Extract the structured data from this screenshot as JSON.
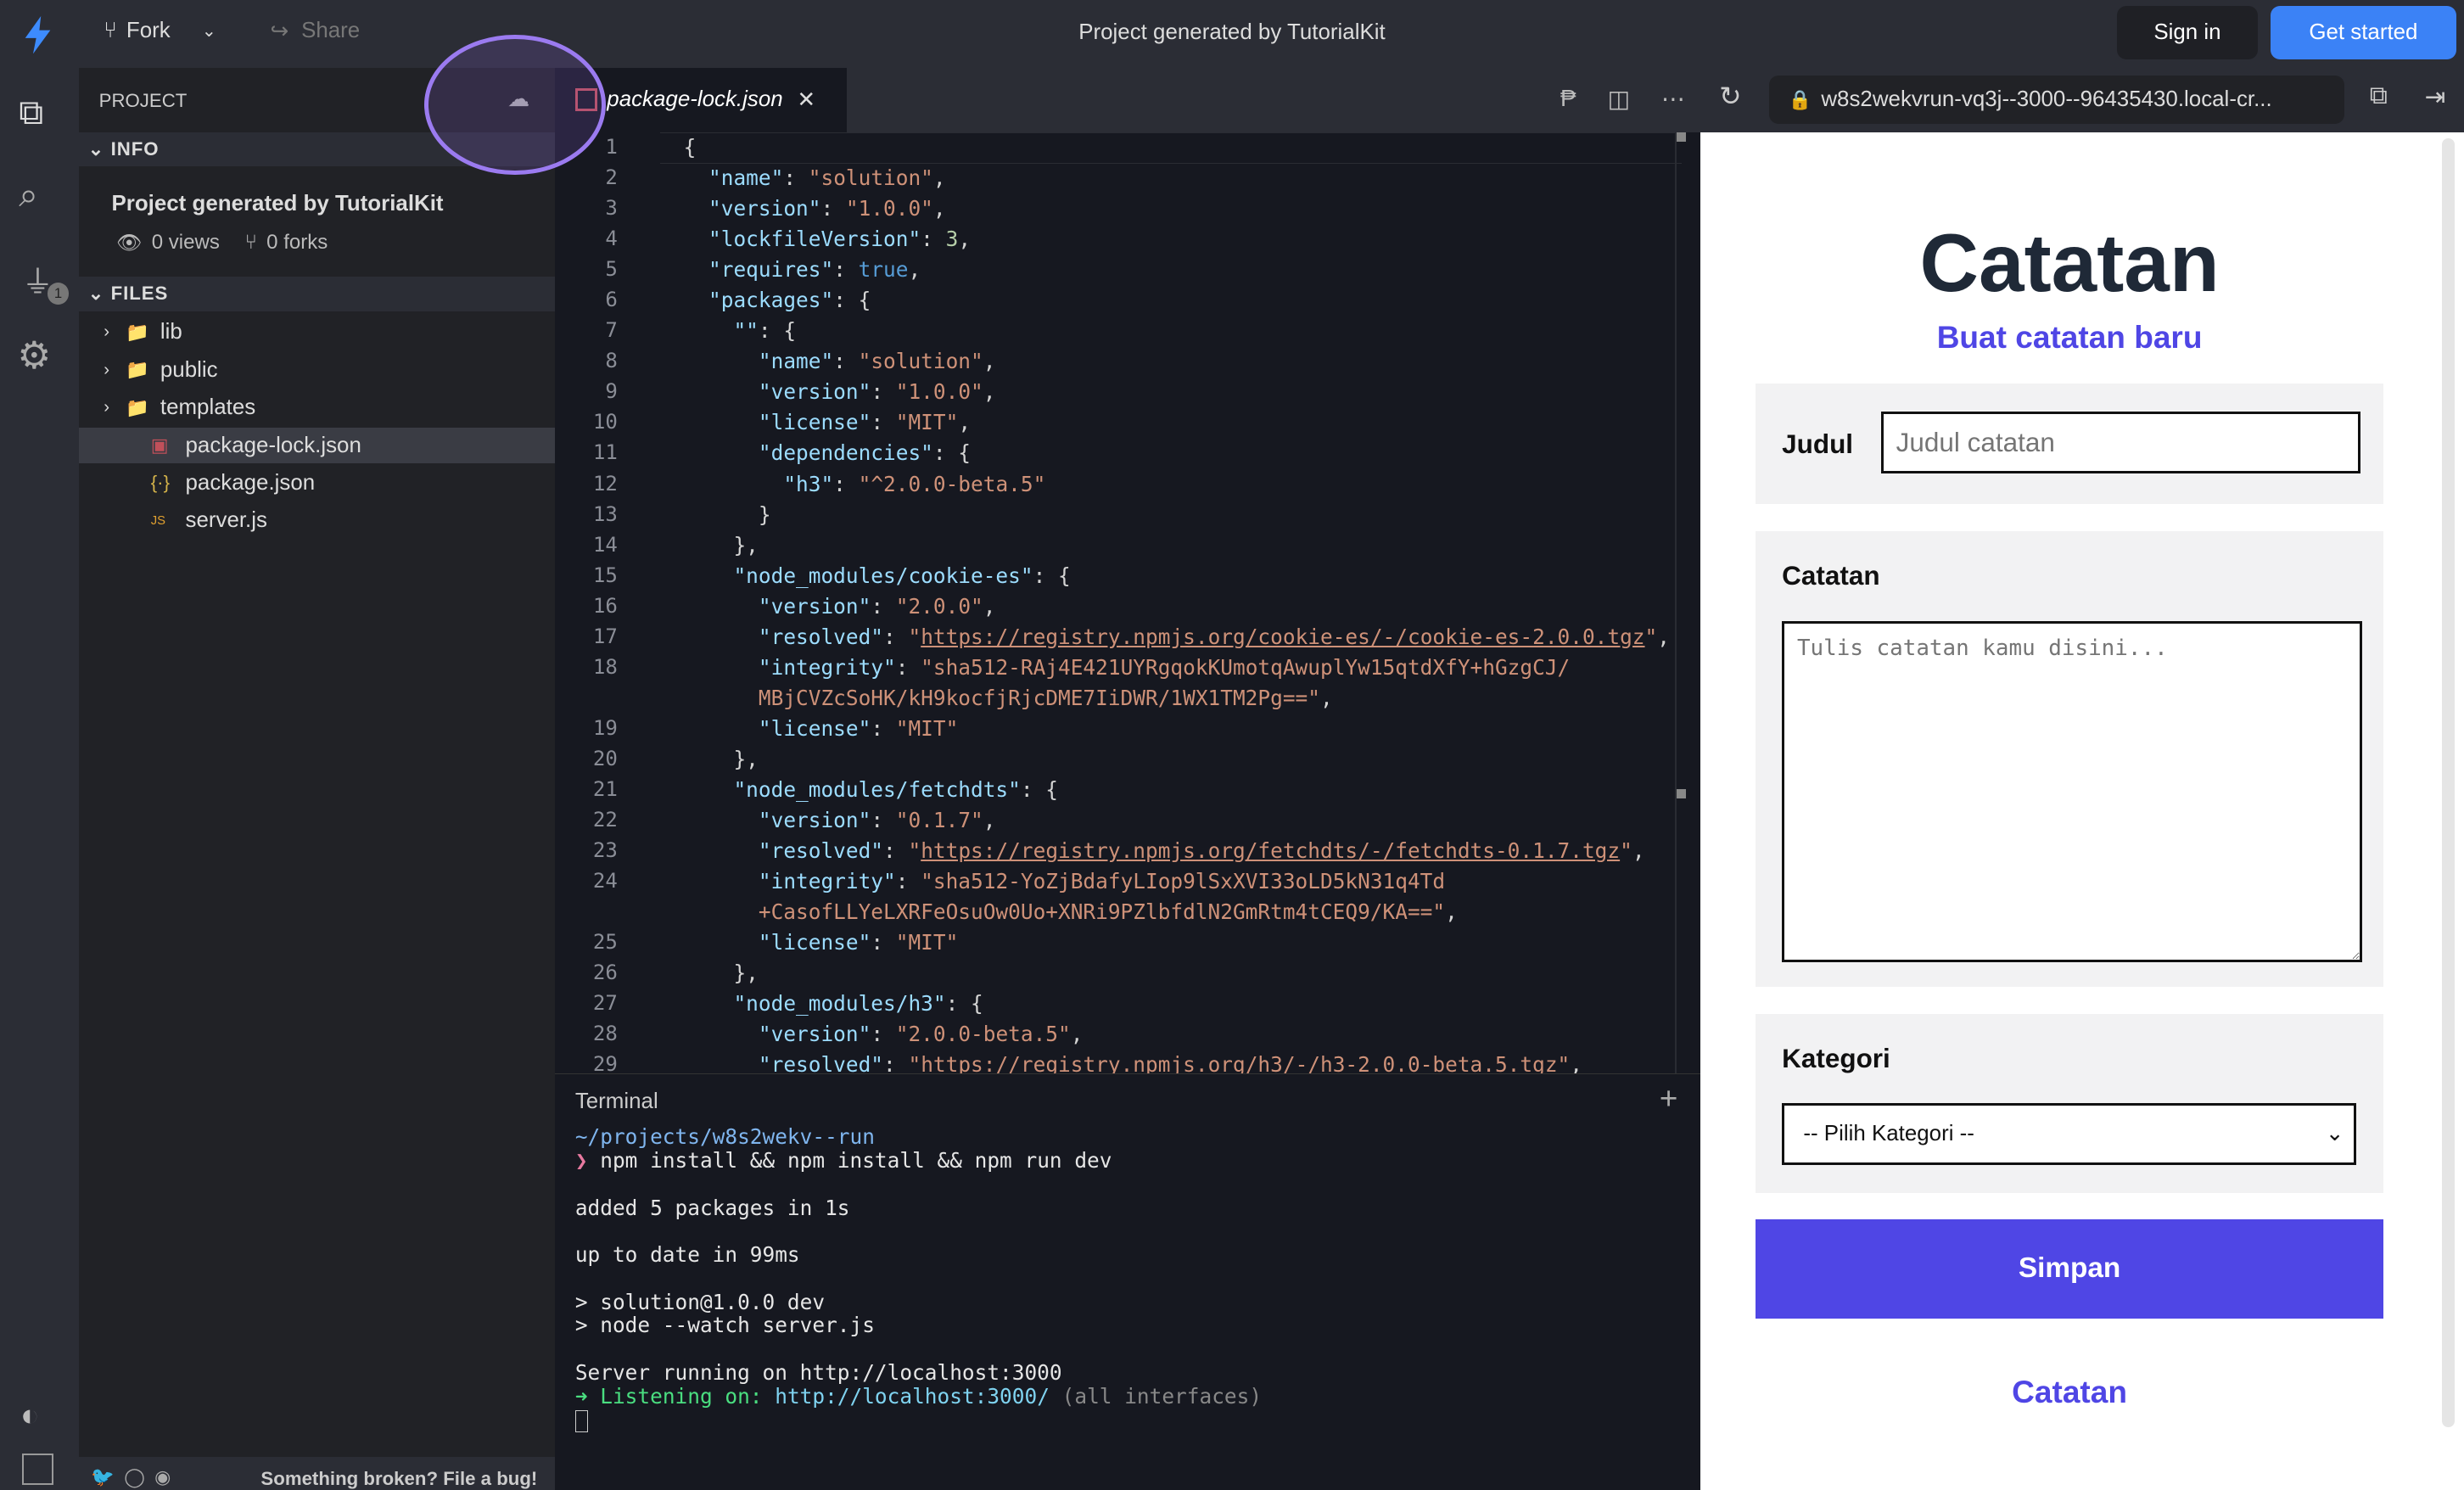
{
  "topbar": {
    "fork": "Fork",
    "share": "Share",
    "title": "Project generated by TutorialKit",
    "sign_in": "Sign in",
    "get_started": "Get started"
  },
  "sidebar": {
    "project": "PROJECT",
    "info": "INFO",
    "project_title": "Project generated by TutorialKit",
    "views": "0 views",
    "forks": "0 forks",
    "files": "FILES",
    "badge": "1",
    "items": [
      {
        "label": "lib",
        "type": "folder"
      },
      {
        "label": "public",
        "type": "folder"
      },
      {
        "label": "templates",
        "type": "folder"
      },
      {
        "label": "package-lock.json",
        "type": "npm"
      },
      {
        "label": "package.json",
        "type": "json"
      },
      {
        "label": "server.js",
        "type": "js"
      }
    ],
    "footer": "Something broken? File a bug!"
  },
  "editor": {
    "tab": "package-lock.json",
    "url": "w8s2wekvrun-vq3j--3000--96435430.local-cr...",
    "lines": [
      [
        "1",
        [
          [
            "p",
            "{"
          ]
        ]
      ],
      [
        "2",
        [
          [
            "p",
            "  "
          ],
          [
            "k",
            "\"name\""
          ],
          [
            "p",
            ": "
          ],
          [
            "s",
            "\"solution\""
          ],
          [
            "p",
            ","
          ]
        ]
      ],
      [
        "3",
        [
          [
            "p",
            "  "
          ],
          [
            "k",
            "\"version\""
          ],
          [
            "p",
            ": "
          ],
          [
            "s",
            "\"1.0.0\""
          ],
          [
            "p",
            ","
          ]
        ]
      ],
      [
        "4",
        [
          [
            "p",
            "  "
          ],
          [
            "k",
            "\"lockfileVersion\""
          ],
          [
            "p",
            ": "
          ],
          [
            "n",
            "3"
          ],
          [
            "p",
            ","
          ]
        ]
      ],
      [
        "5",
        [
          [
            "p",
            "  "
          ],
          [
            "k",
            "\"requires\""
          ],
          [
            "p",
            ": "
          ],
          [
            "b",
            "true"
          ],
          [
            "p",
            ","
          ]
        ]
      ],
      [
        "6",
        [
          [
            "p",
            "  "
          ],
          [
            "k",
            "\"packages\""
          ],
          [
            "p",
            ": {"
          ]
        ]
      ],
      [
        "7",
        [
          [
            "p",
            "    "
          ],
          [
            "k",
            "\"\""
          ],
          [
            "p",
            ": {"
          ]
        ]
      ],
      [
        "8",
        [
          [
            "p",
            "      "
          ],
          [
            "k",
            "\"name\""
          ],
          [
            "p",
            ": "
          ],
          [
            "s",
            "\"solution\""
          ],
          [
            "p",
            ","
          ]
        ]
      ],
      [
        "9",
        [
          [
            "p",
            "      "
          ],
          [
            "k",
            "\"version\""
          ],
          [
            "p",
            ": "
          ],
          [
            "s",
            "\"1.0.0\""
          ],
          [
            "p",
            ","
          ]
        ]
      ],
      [
        "10",
        [
          [
            "p",
            "      "
          ],
          [
            "k",
            "\"license\""
          ],
          [
            "p",
            ": "
          ],
          [
            "s",
            "\"MIT\""
          ],
          [
            "p",
            ","
          ]
        ]
      ],
      [
        "11",
        [
          [
            "p",
            "      "
          ],
          [
            "k",
            "\"dependencies\""
          ],
          [
            "p",
            ": {"
          ]
        ]
      ],
      [
        "12",
        [
          [
            "p",
            "        "
          ],
          [
            "k",
            "\"h3\""
          ],
          [
            "p",
            ": "
          ],
          [
            "s",
            "\"^2.0.0-beta.5\""
          ]
        ]
      ],
      [
        "13",
        [
          [
            "p",
            "      }"
          ]
        ]
      ],
      [
        "14",
        [
          [
            "p",
            "    },"
          ]
        ]
      ],
      [
        "15",
        [
          [
            "p",
            "    "
          ],
          [
            "k",
            "\"node_modules/cookie-es\""
          ],
          [
            "p",
            ": {"
          ]
        ]
      ],
      [
        "16",
        [
          [
            "p",
            "      "
          ],
          [
            "k",
            "\"version\""
          ],
          [
            "p",
            ": "
          ],
          [
            "s",
            "\"2.0.0\""
          ],
          [
            "p",
            ","
          ]
        ]
      ],
      [
        "17",
        [
          [
            "p",
            "      "
          ],
          [
            "k",
            "\"resolved\""
          ],
          [
            "p",
            ": "
          ],
          [
            "s",
            "\""
          ],
          [
            "u",
            "https://registry.npmjs.org/cookie-es/-/cookie-es-2.0.0.tgz"
          ],
          [
            "s",
            "\""
          ],
          [
            "p",
            ","
          ]
        ]
      ],
      [
        "18",
        [
          [
            "p",
            "      "
          ],
          [
            "k",
            "\"integrity\""
          ],
          [
            "p",
            ": "
          ],
          [
            "s",
            "\"sha512-RAj4E421UYRgqokKUmotqAwuplYw15qtdXfY+hGzgCJ/"
          ]
        ]
      ],
      [
        "",
        [
          [
            "s",
            "      MBjCVZcSoHK/kH9kocfjRjcDME7IiDWR/1WX1TM2Pg==\""
          ],
          [
            "p",
            ","
          ]
        ]
      ],
      [
        "19",
        [
          [
            "p",
            "      "
          ],
          [
            "k",
            "\"license\""
          ],
          [
            "p",
            ": "
          ],
          [
            "s",
            "\"MIT\""
          ]
        ]
      ],
      [
        "20",
        [
          [
            "p",
            "    },"
          ]
        ]
      ],
      [
        "21",
        [
          [
            "p",
            "    "
          ],
          [
            "k",
            "\"node_modules/fetchdts\""
          ],
          [
            "p",
            ": {"
          ]
        ]
      ],
      [
        "22",
        [
          [
            "p",
            "      "
          ],
          [
            "k",
            "\"version\""
          ],
          [
            "p",
            ": "
          ],
          [
            "s",
            "\"0.1.7\""
          ],
          [
            "p",
            ","
          ]
        ]
      ],
      [
        "23",
        [
          [
            "p",
            "      "
          ],
          [
            "k",
            "\"resolved\""
          ],
          [
            "p",
            ": "
          ],
          [
            "s",
            "\""
          ],
          [
            "u",
            "https://registry.npmjs.org/fetchdts/-/fetchdts-0.1.7.tgz"
          ],
          [
            "s",
            "\""
          ],
          [
            "p",
            ","
          ]
        ]
      ],
      [
        "24",
        [
          [
            "p",
            "      "
          ],
          [
            "k",
            "\"integrity\""
          ],
          [
            "p",
            ": "
          ],
          [
            "s",
            "\"sha512-YoZjBdafyLIop9lSxXVI33oLD5kN31q4Td"
          ]
        ]
      ],
      [
        "",
        [
          [
            "s",
            "      +CasofLLYeLXRFeOsuOw0Uo+XNRi9PZlbfdlN2GmRtm4tCEQ9/KA==\""
          ],
          [
            "p",
            ","
          ]
        ]
      ],
      [
        "25",
        [
          [
            "p",
            "      "
          ],
          [
            "k",
            "\"license\""
          ],
          [
            "p",
            ": "
          ],
          [
            "s",
            "\"MIT\""
          ]
        ]
      ],
      [
        "26",
        [
          [
            "p",
            "    },"
          ]
        ]
      ],
      [
        "27",
        [
          [
            "p",
            "    "
          ],
          [
            "k",
            "\"node_modules/h3\""
          ],
          [
            "p",
            ": {"
          ]
        ]
      ],
      [
        "28",
        [
          [
            "p",
            "      "
          ],
          [
            "k",
            "\"version\""
          ],
          [
            "p",
            ": "
          ],
          [
            "s",
            "\"2.0.0-beta.5\""
          ],
          [
            "p",
            ","
          ]
        ]
      ],
      [
        "29",
        [
          [
            "p",
            "      "
          ],
          [
            "k",
            "\"resolved\""
          ],
          [
            "p",
            ": "
          ],
          [
            "s",
            "\""
          ],
          [
            "u",
            "https://registry.npmjs.org/h3/-/h3-2.0.0-beta.5.tgz"
          ],
          [
            "s",
            "\""
          ],
          [
            "p",
            ","
          ]
        ]
      ]
    ]
  },
  "terminal": {
    "title": "Terminal",
    "cwd": "~/projects/w8s2wekv--run",
    "prompt": "❯",
    "cmd": "npm install && npm install && npm run dev",
    "out1": "added 5 packages in 1s",
    "out2": "up to date in 99ms",
    "out3": "> solution@1.0.0 dev",
    "out4": "> node --watch server.js",
    "out5": "Server running on http://localhost:3000",
    "arrow": "➜",
    "listen": "Listening on:",
    "listen_url": "http://localhost:3000/",
    "listen_note": "(all interfaces)"
  },
  "preview": {
    "title": "Catatan",
    "subtitle": "Buat catatan baru",
    "judul_label": "Judul",
    "judul_placeholder": "Judul catatan",
    "catatan_label": "Catatan",
    "catatan_placeholder": "Tulis catatan kamu disini...",
    "kategori_label": "Kategori",
    "kategori_selected": "-- Pilih Kategori --",
    "save": "Simpan",
    "list_title": "Catatan",
    "accent": "#4f46e5"
  }
}
